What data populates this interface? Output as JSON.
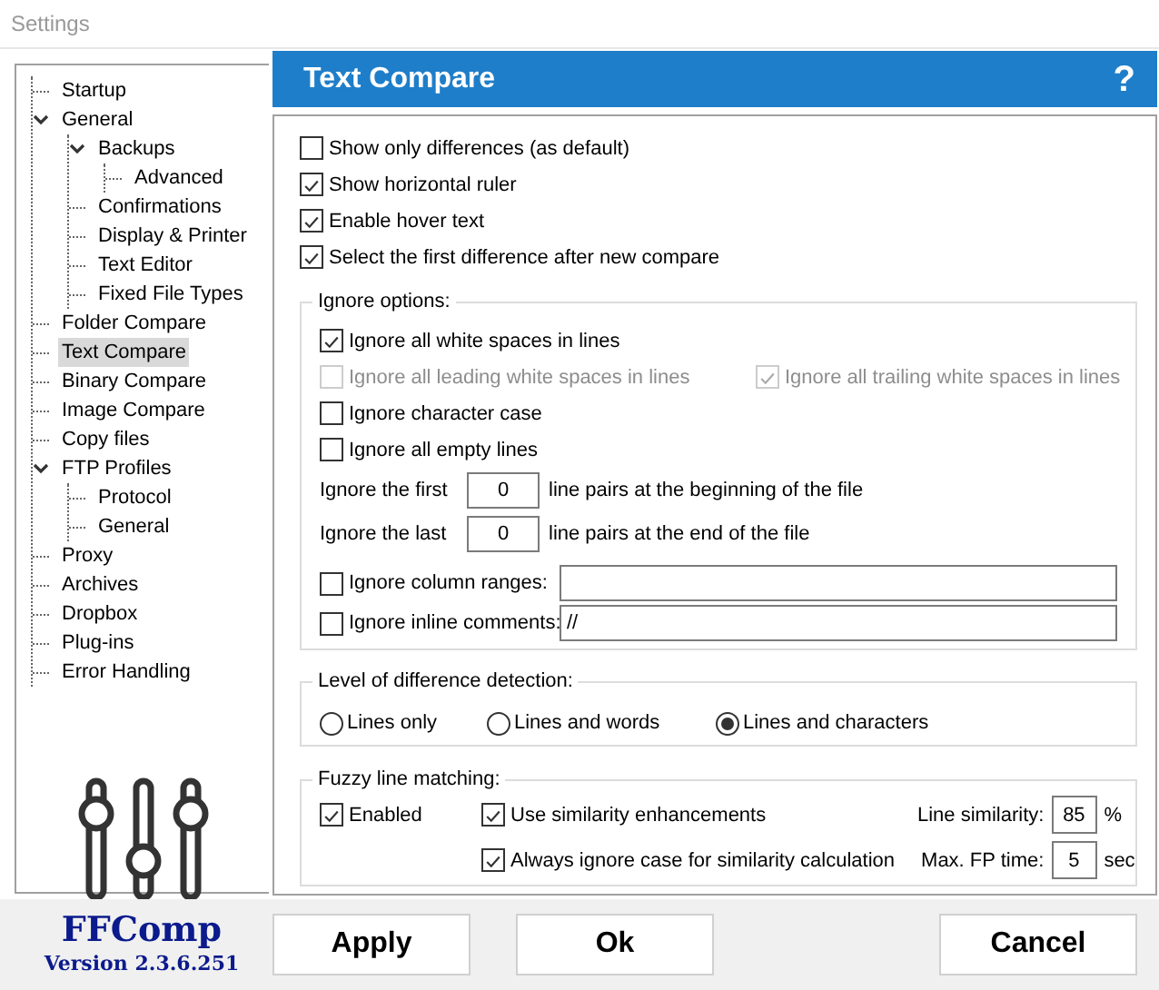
{
  "window": {
    "title": "Settings"
  },
  "sidebar": {
    "items": [
      {
        "label": "Startup",
        "selected": false
      },
      {
        "label": "General",
        "selected": false,
        "expanded": true,
        "children": [
          {
            "label": "Backups",
            "selected": false,
            "expanded": true,
            "children": [
              {
                "label": "Advanced",
                "selected": false
              }
            ]
          },
          {
            "label": "Confirmations",
            "selected": false
          },
          {
            "label": "Display & Printer",
            "selected": false
          },
          {
            "label": "Text Editor",
            "selected": false
          },
          {
            "label": "Fixed File Types",
            "selected": false
          }
        ]
      },
      {
        "label": "Folder Compare",
        "selected": false
      },
      {
        "label": "Text Compare",
        "selected": true
      },
      {
        "label": "Binary Compare",
        "selected": false
      },
      {
        "label": "Image Compare",
        "selected": false
      },
      {
        "label": "Copy files",
        "selected": false
      },
      {
        "label": "FTP Profiles",
        "selected": false,
        "expanded": true,
        "children": [
          {
            "label": "Protocol",
            "selected": false
          },
          {
            "label": "General",
            "selected": false
          }
        ]
      },
      {
        "label": "Proxy",
        "selected": false
      },
      {
        "label": "Archives",
        "selected": false
      },
      {
        "label": "Dropbox",
        "selected": false
      },
      {
        "label": "Plug-ins",
        "selected": false
      },
      {
        "label": "Error Handling",
        "selected": false
      }
    ]
  },
  "panel": {
    "title": "Text Compare",
    "help": "?"
  },
  "general_options": [
    {
      "label": "Show only differences (as default)",
      "checked": false
    },
    {
      "label": "Show horizontal ruler",
      "checked": true
    },
    {
      "label": "Enable hover text",
      "checked": true
    },
    {
      "label": "Select the first difference after new compare",
      "checked": true
    }
  ],
  "ignore_options": {
    "legend": "Ignore options:",
    "checks": [
      {
        "label": "Ignore all white spaces in lines",
        "checked": true,
        "disabled": false
      },
      {
        "label": "Ignore all leading white spaces in lines",
        "checked": false,
        "disabled": true
      },
      {
        "label": "Ignore all trailing white spaces in lines",
        "checked": true,
        "disabled": true
      },
      {
        "label": "Ignore character case",
        "checked": false,
        "disabled": false
      },
      {
        "label": "Ignore all empty lines",
        "checked": false,
        "disabled": false
      }
    ],
    "line_pairs": [
      {
        "label": "Ignore the first",
        "value": "0",
        "suffix": "line pairs at the beginning of the file"
      },
      {
        "label": "Ignore the last",
        "value": "0",
        "suffix": "line pairs at the end of the file"
      }
    ],
    "text_filters": [
      {
        "label": "Ignore column ranges:",
        "checked": false
      },
      {
        "label": "Ignore inline comments:",
        "checked": false,
        "value": "//"
      }
    ]
  },
  "detection_level": {
    "legend": "Level of difference detection:",
    "options": [
      {
        "label": "Lines only",
        "selected": false
      },
      {
        "label": "Lines and words",
        "selected": false
      },
      {
        "label": "Lines and characters",
        "selected": true
      }
    ]
  },
  "fuzzy_matching": {
    "legend": "Fuzzy line matching:",
    "enabled": {
      "label": "Enabled",
      "checked": true
    },
    "enhancements": {
      "label": "Use similarity enhancements",
      "checked": true
    },
    "ignore_case": {
      "label": "Always ignore case for similarity calculation",
      "checked": true
    },
    "line_similarity": {
      "label": "Line similarity:",
      "value": "85",
      "unit": "%"
    },
    "max_fp_time": {
      "label": "Max. FP time:",
      "value": "5",
      "unit": "sec"
    }
  },
  "footer": {
    "app_name": "FFComp",
    "version": "Version 2.3.6.251"
  },
  "buttons": [
    "Apply",
    "Ok",
    "Cancel"
  ]
}
